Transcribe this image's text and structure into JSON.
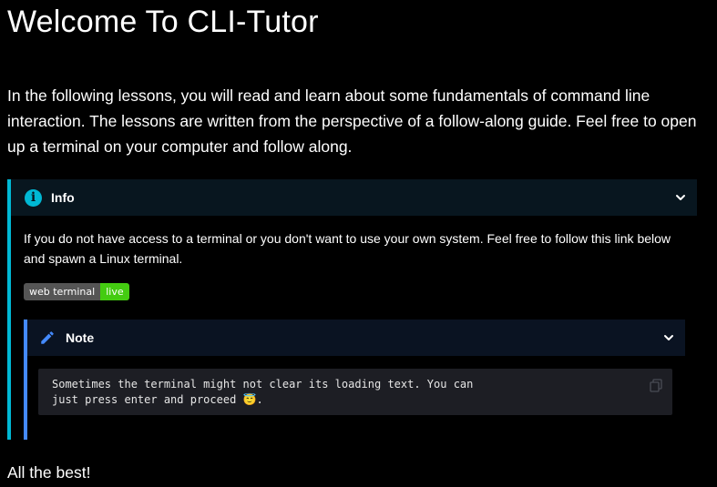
{
  "page": {
    "title": "Welcome To CLI-Tutor",
    "intro": "In the following lessons, you will read and learn about some fundamentals of command line interaction. The lessons are written from the perspective of a follow-along guide. Feel free to open up a terminal on your computer and follow along.",
    "closing": "All the best!"
  },
  "info_admonition": {
    "title": "Info",
    "icon": "info-icon",
    "accent_color": "#00b8d4",
    "body": "If you do not have access to a terminal or you don't want to use your own system. Feel free to follow this link below and spawn a Linux terminal.",
    "badge": {
      "left_label": "web terminal",
      "right_label": "live",
      "left_color": "#555555",
      "right_color": "#44cc11"
    }
  },
  "note_admonition": {
    "title": "Note",
    "icon": "pencil-icon",
    "accent_color": "#448aff",
    "code_line_1": "Sometimes the terminal might not clear its loading text. You can",
    "code_line_2_text": "just press enter and proceed ",
    "code_emoji": "😇",
    "code_line_2_end": "."
  },
  "icons": {
    "chevron": "chevron-down-icon",
    "copy": "copy-icon"
  }
}
